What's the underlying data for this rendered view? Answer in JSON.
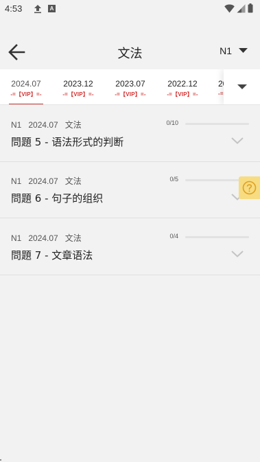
{
  "status_bar": {
    "time": "4:53",
    "notice_badge": "A"
  },
  "app_bar": {
    "title": "文法",
    "level": "N1"
  },
  "tabs": [
    {
      "year": "2024.07",
      "vip": "-=【VIP】=-"
    },
    {
      "year": "2023.12",
      "vip": "-=【VIP】=-"
    },
    {
      "year": "2023.07",
      "vip": "-=【VIP】=-"
    },
    {
      "year": "2022.12",
      "vip": "-=【VIP】=-"
    },
    {
      "year": "20",
      "vip": "-="
    }
  ],
  "active_tab": 0,
  "questions": [
    {
      "level": "N1",
      "date": "2024.07",
      "category": "文法",
      "progress": "0/10",
      "progress_value": 0,
      "title": "問題 5  - 语法形式的判断"
    },
    {
      "level": "N1",
      "date": "2024.07",
      "category": "文法",
      "progress": "0/5",
      "progress_value": 0,
      "title": "問題 6  - 句子的组织"
    },
    {
      "level": "N1",
      "date": "2024.07",
      "category": "文法",
      "progress": "0/4",
      "progress_value": 0,
      "title": "問題 7  - 文章语法"
    }
  ],
  "icons": {
    "back": "arrow-left-icon",
    "level_dropdown": "caret-down-icon",
    "tabs_more": "caret-down-icon",
    "expand": "chevron-down-icon",
    "help": "question-circle-icon"
  },
  "colors": {
    "accent": "#d23030",
    "help_bg": "#f7dc82",
    "background": "#f2f2f2"
  }
}
